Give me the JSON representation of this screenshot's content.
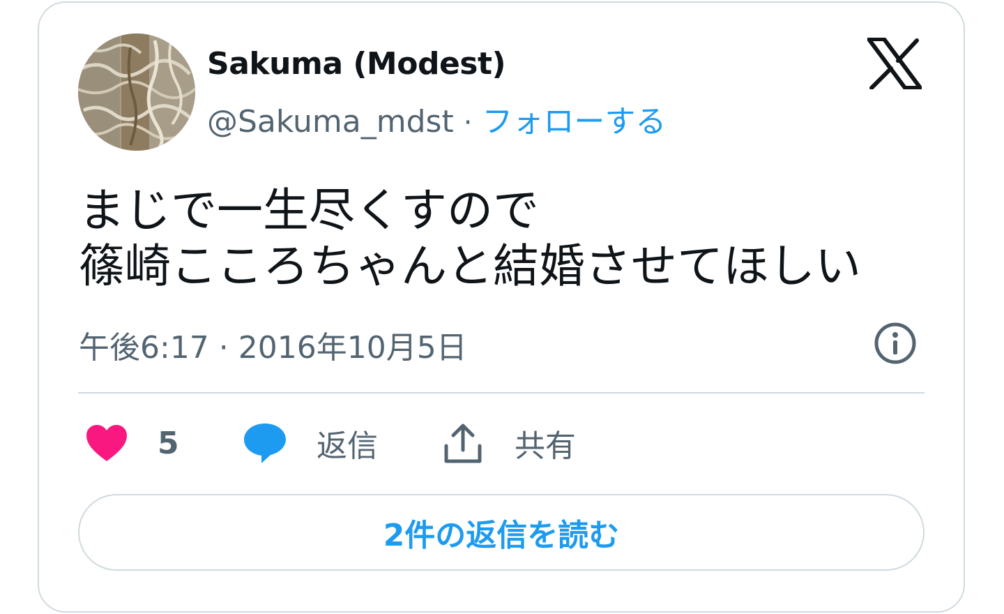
{
  "author": {
    "display_name": "Sakuma (Modest)",
    "handle": "@Sakuma_mdst",
    "separator": "·",
    "follow_label": "フォローする"
  },
  "brand": {
    "logo_icon": "x-logo-icon",
    "logo_color": "#0f1419"
  },
  "tweet": {
    "line1": "まじで一生尽くすので",
    "line2": "篠崎こころちゃんと結婚させてほしい",
    "timestamp": "午後6:17 · 2016年10月5日",
    "info_icon": "info-icon"
  },
  "actions": {
    "like": {
      "icon": "heart-icon",
      "count": "5",
      "color": "#f91880"
    },
    "reply": {
      "icon": "speech-bubble-icon",
      "label": "返信",
      "color": "#1d9bf0"
    },
    "share": {
      "icon": "share-upload-icon",
      "label": "共有"
    }
  },
  "read_replies_label": "2件の返信を読む",
  "colors": {
    "text_primary": "#0f1419",
    "text_secondary": "#536471",
    "accent": "#1d9bf0",
    "border": "#cfd9de"
  }
}
